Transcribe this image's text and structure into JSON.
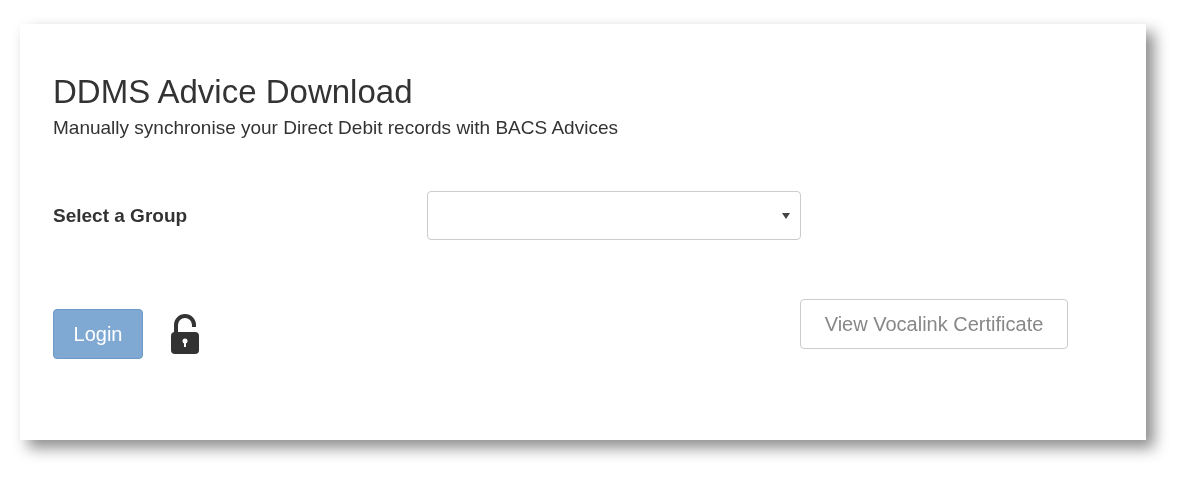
{
  "title": "DDMS Advice Download",
  "subtitle": "Manually synchronise your Direct Debit records with BACS Advices",
  "group_select": {
    "label": "Select a Group"
  },
  "login_button": {
    "label": "Login",
    "disabled": true
  },
  "lock": {
    "locked": false
  },
  "certificate_button": {
    "label": "View Vocalink Certificate",
    "disabled": true
  }
}
